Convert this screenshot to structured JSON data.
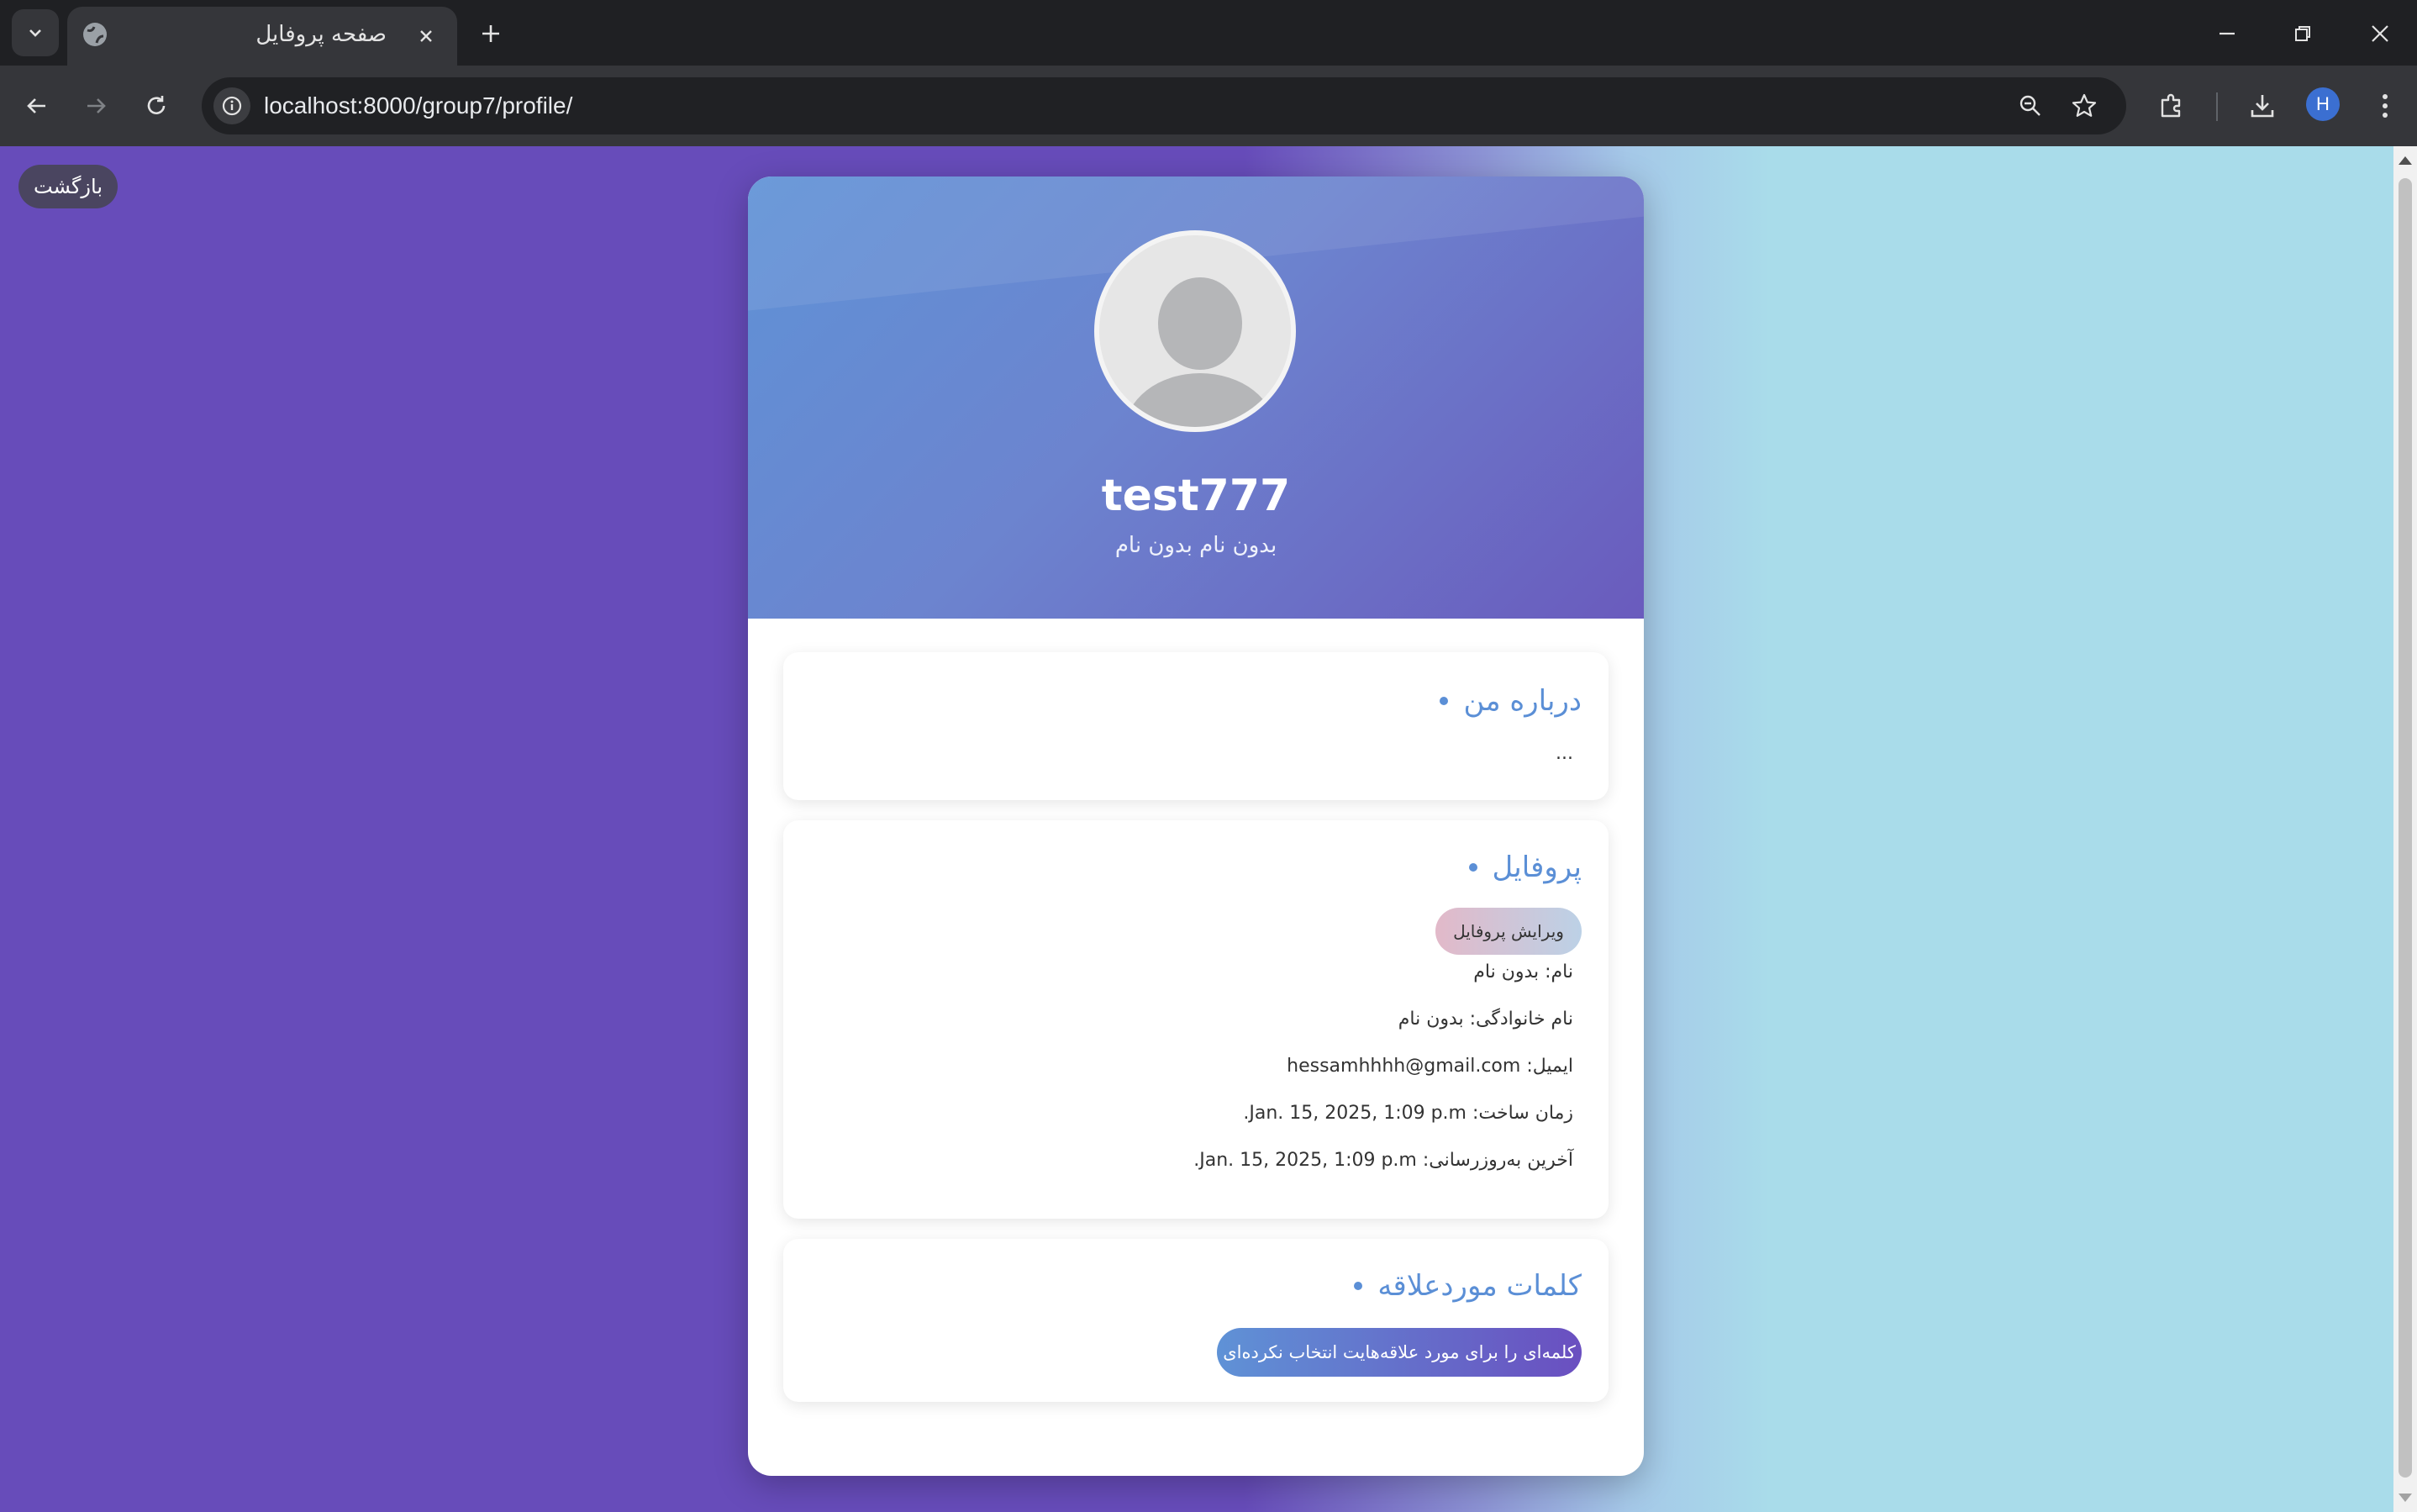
{
  "browser": {
    "tab_title": "صفحه پروفایل",
    "url": "localhost:8000/group7/profile/",
    "profile_initial": "H"
  },
  "page": {
    "back_label": "بازگشت",
    "username": "test777",
    "full_name": "بدون نام بدون نام",
    "about": {
      "title": "درباره من",
      "text": "..."
    },
    "profile": {
      "title": "پروفایل",
      "edit_label": "ویرایش پروفایل",
      "first_name": "نام: بدون نام",
      "last_name": "نام خانوادگی: بدون نام",
      "email": "ایمیل: hessamhhhh@gmail.com",
      "created": "زمان ساخت: Jan. 15, 2025, 1:09 p.m.",
      "updated": "آخرین به‌روزرسانی: Jan. 15, 2025, 1:09 p.m."
    },
    "keywords": {
      "title": "کلمات موردعلاقه",
      "empty_label": "کلمه‌ای را برای مورد علاقه‌هایت انتخاب نکرده‌ای"
    }
  },
  "colors": {
    "accent": "#5b8fd6",
    "page_left": "#674cba",
    "page_right": "#a9dcea"
  }
}
